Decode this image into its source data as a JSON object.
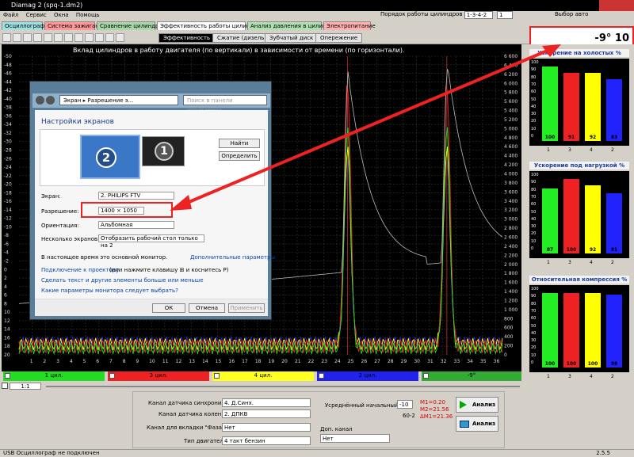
{
  "window": {
    "title": "Diamag 2 (spq-1.dm2)"
  },
  "menu": [
    "Файл",
    "Сервис",
    "Окна",
    "Помощь"
  ],
  "header": {
    "cylinder_order_label": "Порядок работы цилиндров",
    "cylinder_order_value": "1-3-4-2",
    "cylinder_select": "1",
    "auto_select": "Выбор авто"
  },
  "tabs": [
    {
      "label": "Осциллограф",
      "color": "#9fe0e0"
    },
    {
      "label": "Система зажигания",
      "color": "#ff9999"
    },
    {
      "label": "Сравнение цилиндров",
      "color": "#a8d8a8"
    },
    {
      "label": "Эффективность работы цилиндров",
      "color": "#ffffff"
    },
    {
      "label": "Анализ давления в цилиндре",
      "color": "#b0e0b0"
    },
    {
      "label": "Электропитание",
      "color": "#ffb0b0"
    }
  ],
  "subtabs": [
    "Эффективность",
    "Сжатие (дизель)",
    "Зубчатый диск",
    "Опережение"
  ],
  "chart_data": {
    "type": "line",
    "title": "Вклад цилиндров в работу двигателя (по вертикали) в зависимости от времени (по горизонтали).",
    "y_left_ticks": [
      -50,
      -48,
      -46,
      -44,
      -42,
      -40,
      -38,
      -36,
      -34,
      -32,
      -30,
      -28,
      -26,
      -24,
      -22,
      -20,
      -18,
      -16,
      -14,
      -12,
      -10,
      -8,
      -6,
      -4,
      -2,
      0,
      2,
      4,
      6,
      8,
      10,
      12,
      14,
      16,
      18,
      20
    ],
    "y_right_ticks": [
      6600,
      6400,
      6200,
      6000,
      5800,
      5600,
      5400,
      5200,
      5000,
      4800,
      4600,
      4400,
      4200,
      4000,
      3800,
      3600,
      3400,
      3200,
      3000,
      2800,
      2600,
      2400,
      2200,
      2000,
      1800,
      1600,
      1400,
      1200,
      1000,
      800,
      600,
      400,
      200,
      0
    ],
    "x_ticks": [
      1,
      2,
      3,
      4,
      5,
      6,
      7,
      8,
      9,
      10,
      11,
      12,
      13,
      14,
      15,
      16,
      17,
      18,
      19,
      20,
      21,
      22,
      23,
      24,
      25,
      26,
      27,
      28,
      29,
      30,
      31,
      32,
      33,
      34,
      35,
      36
    ],
    "xlim": [
      0,
      36.5
    ],
    "ylim_left": [
      20,
      -50
    ],
    "peaks_x": [
      24.8,
      32.3
    ],
    "grid": true
  },
  "channels": [
    {
      "label": "1 цил.",
      "color": "#22dd22"
    },
    {
      "label": "3 цил.",
      "color": "#ee2222"
    },
    {
      "label": "4 цил.",
      "color": "#ffff22"
    },
    {
      "label": "2 цил.",
      "color": "#2222ee"
    },
    {
      "label": "-9°",
      "color": "#33aa33"
    }
  ],
  "zoom": {
    "value": "1:1"
  },
  "controls": {
    "sync_label": "Канал датчика синхронизации",
    "sync_value": "4. Д.Синх.",
    "crank_label": "Канал датчика коленвала",
    "crank_value": "2. ДПКВ",
    "phase_label": "Канал для вкладки \"Фаза\"",
    "phase_value": "Нет",
    "engine_label": "Тип двигателя",
    "engine_value": "4 такт бензин",
    "uoz_label": "Усреднённый начальный УОЗ",
    "uoz_value": "-10",
    "teeth": "60-2",
    "m1": "M1=0.20",
    "m2": "M2=21.56",
    "dm": "ΔM1=21.36",
    "extra_label": "Доп. канал",
    "extra_value": "Нет",
    "analyze1": "Анализ",
    "analyze2": "Анализ"
  },
  "angle": {
    "value": "-9°",
    "extra": "10"
  },
  "panels": [
    {
      "title": "Ускорение на холостых %",
      "values": [
        100,
        91,
        92,
        83
      ],
      "labels": [
        "1",
        "3",
        "4",
        "2"
      ]
    },
    {
      "title": "Ускорение под нагрузкой %",
      "values": [
        87,
        100,
        92,
        81
      ],
      "labels": [
        "1",
        "3",
        "4",
        "2"
      ]
    },
    {
      "title": "Относительная компрессия %",
      "values": [
        100,
        100,
        100,
        98
      ],
      "labels": [
        "1",
        "3",
        "4",
        "2"
      ]
    }
  ],
  "panel_ticks": [
    "100",
    "90",
    "80",
    "70",
    "60",
    "50",
    "40",
    "30",
    "20",
    "10",
    "0"
  ],
  "bar_colors": [
    "#22ee22",
    "#ee2222",
    "#ffff00",
    "#2222ff"
  ],
  "dialog": {
    "nav_path": "Экран ▸ Разрешение э...",
    "search_placeholder": "Поиск в панели управления",
    "heading": "Настройки экранов",
    "find": "Найти",
    "detect": "Определить",
    "screen_label": "Экран:",
    "screen_value": "2. PHILIPS FTV",
    "resolution_label": "Разрешение:",
    "resolution_value": "1400 × 1050",
    "orientation_label": "Ориентация:",
    "orientation_value": "Альбомная",
    "multi_label": "Несколько экранов:",
    "multi_value": "Отобразить рабочий стол только на 2",
    "primary_note": "В настоящее время это основной монитор.",
    "advanced": "Дополнительные параметры",
    "projector_link": "Подключение к проектору",
    "projector_rest": "(или нажмите клавишу ⊞ и коснитесь P)",
    "text_link": "Сделать текст и другие элементы больше или меньше",
    "which_link": "Какие параметры монитора следует выбрать?",
    "ok": "ОК",
    "cancel": "Отмена",
    "apply": "Применить",
    "monitor1": "1",
    "monitor2": "2"
  },
  "status": {
    "left": "USB Осциллограф не подключен",
    "right": "2.5.5"
  }
}
